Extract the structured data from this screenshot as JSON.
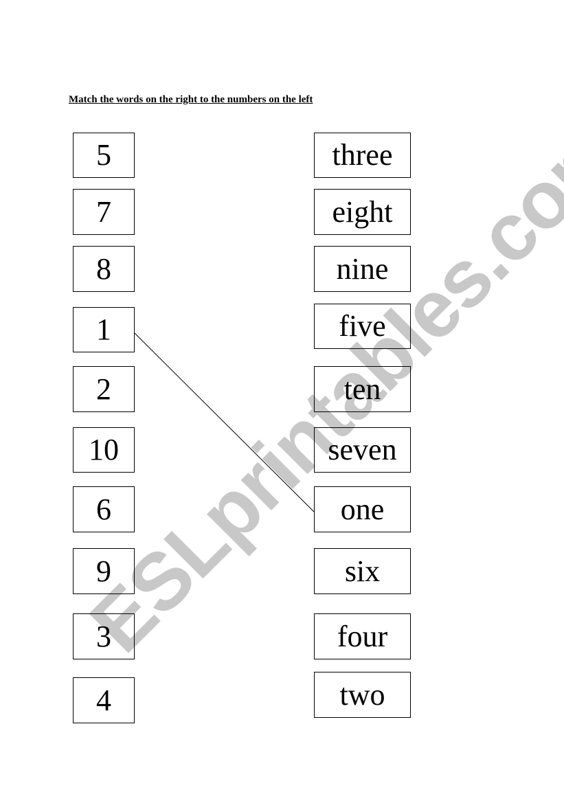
{
  "title": "Match the words on the right to the numbers on the left",
  "numbers": [
    "5",
    "7",
    "8",
    "1",
    "2",
    "10",
    "6",
    "9",
    "3",
    "4"
  ],
  "words": [
    "three",
    "eight",
    "nine",
    "five",
    "ten",
    "seven",
    "one",
    "six",
    "four",
    "two"
  ],
  "example_match": {
    "number": "1",
    "word": "one"
  },
  "watermark": "ESLprintables.com"
}
